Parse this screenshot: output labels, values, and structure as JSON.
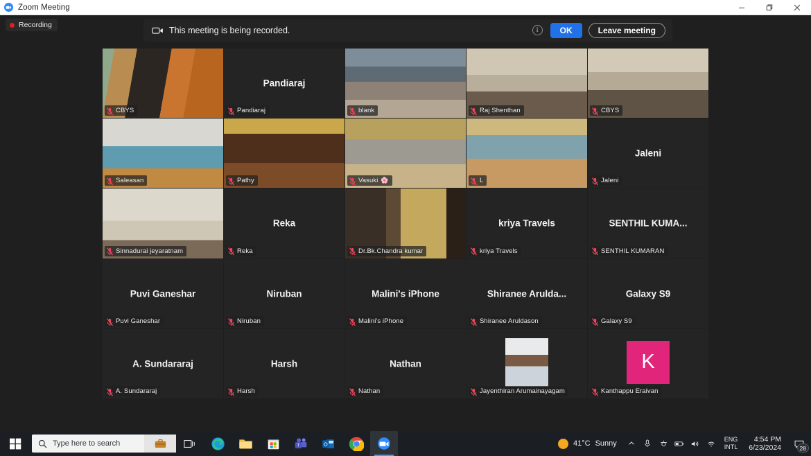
{
  "window": {
    "title": "Zoom Meeting",
    "app_icon": "zoom-icon",
    "controls": {
      "minimize": "minimize-icon",
      "maximize": "restore-icon",
      "close": "close-icon"
    }
  },
  "recording_indicator": {
    "label": "Recording",
    "dot_color": "#e02020"
  },
  "recording_banner": {
    "icon": "video-camera-icon",
    "message": "This meeting is being recorded.",
    "info_icon": "info-icon",
    "ok_label": "OK",
    "leave_label": "Leave meeting",
    "ok_color": "#2172e8"
  },
  "gallery": {
    "columns": 5,
    "rows": 5,
    "active_speaker_border": "#e9e94b",
    "tiles": [
      {
        "display_name": "",
        "label": "CBYS",
        "muted": true,
        "video": true,
        "scene": "man-white-shirt-flowers",
        "speaking": true
      },
      {
        "display_name": "Pandiaraj",
        "label": "Pandiaraj",
        "muted": true,
        "video": false,
        "scene": ""
      },
      {
        "display_name": "",
        "label": "blank",
        "muted": true,
        "video": true,
        "scene": "indoor-group-table"
      },
      {
        "display_name": "",
        "label": "Raj Shenthan",
        "muted": true,
        "video": true,
        "scene": "man-office-certificates"
      },
      {
        "display_name": "",
        "label": "CBYS",
        "muted": true,
        "video": true,
        "scene": "man-office-certificates-2"
      },
      {
        "display_name": "",
        "label": "Saleasan",
        "muted": true,
        "video": true,
        "scene": "hall-blue-walls"
      },
      {
        "display_name": "",
        "label": "Pathy",
        "muted": true,
        "video": true,
        "scene": "temple-hall-arch"
      },
      {
        "display_name": "",
        "label": "Vasuki",
        "muted": true,
        "video": true,
        "scene": "yoga-hall-group",
        "emoji": "🌸"
      },
      {
        "display_name": "",
        "label": "L",
        "muted": true,
        "video": true,
        "scene": "yoga-mats-hall"
      },
      {
        "display_name": "Jaleni",
        "label": "Jaleni",
        "muted": true,
        "video": false,
        "scene": ""
      },
      {
        "display_name": "",
        "label": "Sinnadurai jeyaratnam",
        "muted": true,
        "video": true,
        "scene": "living-room-tv"
      },
      {
        "display_name": "Reka",
        "label": "Reka",
        "muted": true,
        "video": false,
        "scene": ""
      },
      {
        "display_name": "",
        "label": "Dr.Bk.Chandra kumar",
        "muted": true,
        "video": true,
        "scene": "portrait-painting-doorway"
      },
      {
        "display_name": "kriya Travels",
        "label": "kriya Travels",
        "muted": true,
        "video": false,
        "scene": ""
      },
      {
        "display_name": "SENTHIL  KUMA...",
        "label": "SENTHIL KUMARAN",
        "muted": true,
        "video": false,
        "scene": ""
      },
      {
        "display_name": "Puvi Ganeshar",
        "label": "Puvi Ganeshar",
        "muted": true,
        "video": false,
        "scene": ""
      },
      {
        "display_name": "Niruban",
        "label": "Niruban",
        "muted": true,
        "video": false,
        "scene": ""
      },
      {
        "display_name": "Malini's iPhone",
        "label": "Malini's iPhone",
        "muted": true,
        "video": false,
        "scene": ""
      },
      {
        "display_name": "Shiranee  Arulda...",
        "label": "Shiranee Aruldason",
        "muted": true,
        "video": false,
        "scene": ""
      },
      {
        "display_name": "Galaxy S9",
        "label": "Galaxy S9",
        "muted": true,
        "video": false,
        "scene": ""
      },
      {
        "display_name": "A. Sundararaj",
        "label": "A. Sundararaj",
        "muted": true,
        "video": false,
        "scene": ""
      },
      {
        "display_name": "Harsh",
        "label": "Harsh",
        "muted": true,
        "video": false,
        "scene": ""
      },
      {
        "display_name": "Nathan",
        "label": "Nathan",
        "muted": true,
        "video": false,
        "scene": ""
      },
      {
        "display_name": "",
        "label": "Jayenthiran Arumainayagam",
        "muted": true,
        "video": false,
        "scene": "",
        "avatar_photo": true
      },
      {
        "display_name": "",
        "label": "Kanthappu Eraivan",
        "muted": true,
        "video": false,
        "scene": "",
        "avatar_initial": "K",
        "avatar_color": "#e0257a"
      }
    ]
  },
  "taskbar": {
    "start": "windows-start-icon",
    "search_placeholder": "Type here to search",
    "search_icon": "search-icon",
    "briefcase_icon": "briefcase-icon",
    "apps": [
      {
        "name": "task-view-icon",
        "active": false
      },
      {
        "name": "edge-icon",
        "active": false
      },
      {
        "name": "file-explorer-icon",
        "active": false
      },
      {
        "name": "microsoft-store-icon",
        "active": false
      },
      {
        "name": "teams-icon",
        "active": false
      },
      {
        "name": "outlook-icon",
        "active": false
      },
      {
        "name": "chrome-icon",
        "active": false
      },
      {
        "name": "zoom-icon",
        "active": true
      }
    ],
    "tray": {
      "weather_temp": "41°C",
      "weather_desc": "Sunny",
      "chevron": "chevron-up-icon",
      "icons": [
        "microphone-icon",
        "camera-icon",
        "battery-icon",
        "volume-icon",
        "wifi-icon"
      ],
      "lang_line1": "ENG",
      "lang_line2": "INTL",
      "time": "4:54 PM",
      "date": "6/23/2024",
      "notification_count": "28"
    }
  }
}
